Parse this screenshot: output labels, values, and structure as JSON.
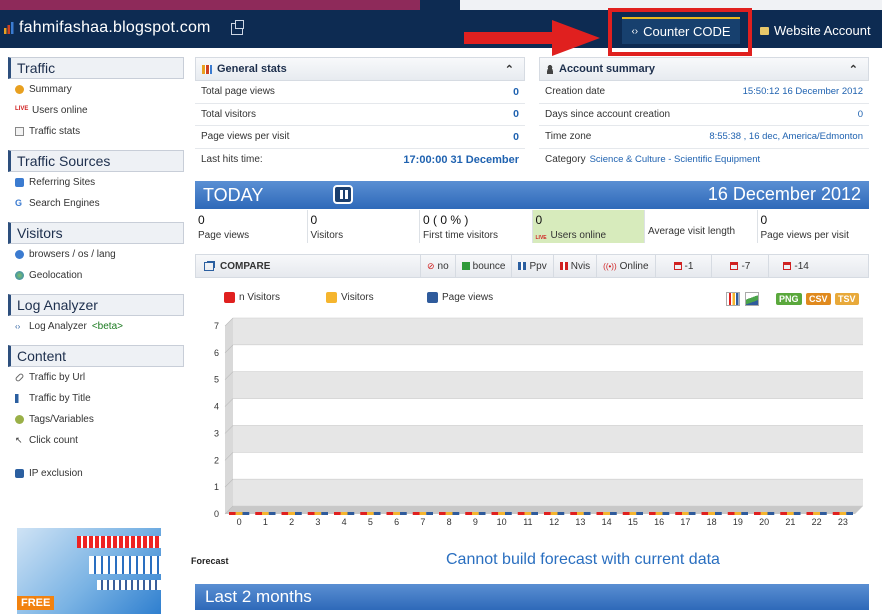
{
  "header": {
    "site_title": "fahmifashaa.blogspot.com",
    "counter_code_label": "Counter CODE",
    "website_account_label": "Website Account"
  },
  "sidebar": {
    "sections": [
      {
        "title": "Traffic",
        "items": [
          "Summary",
          "Users online",
          "Traffic stats"
        ]
      },
      {
        "title": "Traffic Sources",
        "items": [
          "Referring Sites",
          "Search Engines"
        ]
      },
      {
        "title": "Visitors",
        "items": [
          "browsers / os / lang",
          "Geolocation"
        ]
      },
      {
        "title": "Log Analyzer",
        "items": [
          "Log Analyzer"
        ]
      },
      {
        "title": "Content",
        "items": [
          "Traffic by Url",
          "Traffic by Title",
          "Tags/Variables",
          "Click count"
        ]
      }
    ],
    "beta_label": "<beta>",
    "ip_exclusion": "IP exclusion",
    "ad_free_label": "FREE"
  },
  "general_stats": {
    "title": "General stats",
    "rows": [
      {
        "label": "Total page views",
        "value": "0"
      },
      {
        "label": "Total visitors",
        "value": "0"
      },
      {
        "label": "Page views per visit",
        "value": "0"
      },
      {
        "label": "Last hits time:",
        "value": "17:00:00 31 December"
      }
    ]
  },
  "account_summary": {
    "title": "Account summary",
    "rows": [
      {
        "label": "Creation date",
        "value": "15:50:12 16 December 2012"
      },
      {
        "label": "Days since account creation",
        "value": "0"
      },
      {
        "label": "Time zone",
        "value": "8:55:38 , 16 dec, America/Edmonton"
      }
    ],
    "category_label": "Category",
    "category_value": "Science & Culture - Scientific Equipment"
  },
  "today": {
    "label": "TODAY",
    "date": "16 December 2012",
    "metrics": [
      {
        "num": "0",
        "caption": "Page views"
      },
      {
        "num": "0",
        "caption": "Visitors"
      },
      {
        "num": "0 ( 0 % )",
        "caption": "First time visitors"
      },
      {
        "num": "0",
        "caption": "Users online"
      },
      {
        "num": "",
        "caption": "Average visit length"
      },
      {
        "num": "0",
        "caption": "Page views per visit"
      }
    ]
  },
  "compare": {
    "label": "COMPARE",
    "options": [
      "no",
      "bounce",
      "Ppv",
      "Nvis",
      "Online",
      "-1",
      "-7",
      "-14"
    ]
  },
  "legend": [
    {
      "label": "n Visitors",
      "color": "#e0201f"
    },
    {
      "label": "Visitors",
      "color": "#f5b52e"
    },
    {
      "label": "Page views",
      "color": "#2f5b9c"
    }
  ],
  "export": [
    "PNG",
    "CSV",
    "TSV"
  ],
  "chart_data": {
    "type": "bar",
    "categories": [
      "0",
      "1",
      "2",
      "3",
      "4",
      "5",
      "6",
      "7",
      "8",
      "9",
      "10",
      "11",
      "12",
      "13",
      "14",
      "15",
      "16",
      "17",
      "18",
      "19",
      "20",
      "21",
      "22",
      "23"
    ],
    "series": [
      {
        "name": "n Visitors",
        "values": [
          0,
          0,
          0,
          0,
          0,
          0,
          0,
          0,
          0,
          0,
          0,
          0,
          0,
          0,
          0,
          0,
          0,
          0,
          0,
          0,
          0,
          0,
          0,
          0
        ]
      },
      {
        "name": "Visitors",
        "values": [
          0,
          0,
          0,
          0,
          0,
          0,
          0,
          0,
          0,
          0,
          0,
          0,
          0,
          0,
          0,
          0,
          0,
          0,
          0,
          0,
          0,
          0,
          0,
          0
        ]
      },
      {
        "name": "Page views",
        "values": [
          0,
          0,
          0,
          0,
          0,
          0,
          0,
          0,
          0,
          0,
          0,
          0,
          0,
          0,
          0,
          0,
          0,
          0,
          0,
          0,
          0,
          0,
          0,
          0
        ]
      }
    ],
    "ylim": [
      0,
      7
    ],
    "yticks": [
      "0",
      "1",
      "2",
      "3",
      "4",
      "5",
      "6",
      "7"
    ],
    "grid": true
  },
  "forecast": {
    "label": "Forecast",
    "message": "Cannot build forecast with current data"
  },
  "last_months": "Last 2 months"
}
